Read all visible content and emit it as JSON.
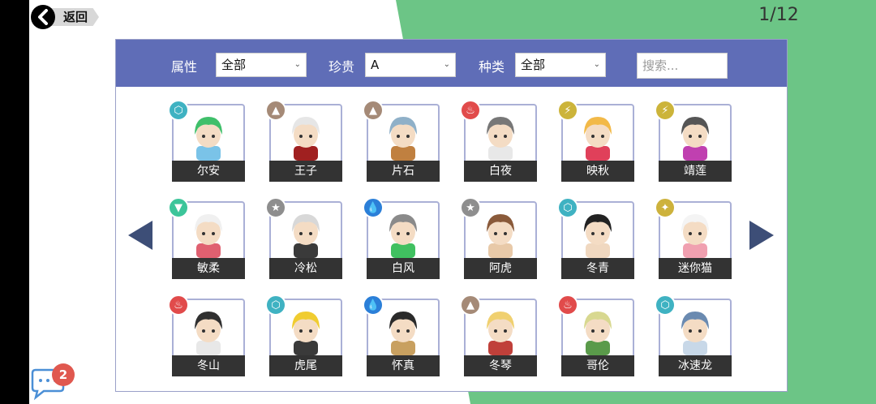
{
  "back": {
    "label": "返回"
  },
  "pagination": {
    "indicator": "1/12"
  },
  "filters": {
    "attribute": {
      "label": "属性",
      "value": "全部"
    },
    "rarity": {
      "label": "珍贵",
      "value": "A"
    },
    "type": {
      "label": "种类",
      "value": "全部"
    },
    "search": {
      "placeholder": "搜索..."
    }
  },
  "elements": {
    "wind": {
      "color": "#3fb2c2",
      "glyph": "⬡"
    },
    "earth": {
      "color": "#a58a77",
      "glyph": "▲"
    },
    "fire": {
      "color": "#e14b4b",
      "glyph": "♨"
    },
    "thunder": {
      "color": "#ccb43a",
      "glyph": "⚡"
    },
    "water": {
      "color": "#2b7fd8",
      "glyph": "💧"
    },
    "nature": {
      "color": "#3cc59a",
      "glyph": "▼"
    },
    "neutral": {
      "color": "#8e8e8e",
      "glyph": "★"
    },
    "light": {
      "color": "#cdb23c",
      "glyph": "✦"
    }
  },
  "characters": [
    {
      "name": "尔安",
      "element": "wind",
      "hair": "#3fbf6a",
      "accent": "#7ac3e8"
    },
    {
      "name": "王子",
      "element": "earth",
      "hair": "#e6e6e6",
      "accent": "#a02020"
    },
    {
      "name": "片石",
      "element": "earth",
      "hair": "#8fb0c8",
      "accent": "#c08040"
    },
    {
      "name": "白夜",
      "element": "fire",
      "hair": "#777777",
      "accent": "#e8e8e8"
    },
    {
      "name": "映秋",
      "element": "thunder",
      "hair": "#f2b948",
      "accent": "#e0405a"
    },
    {
      "name": "靖莲",
      "element": "thunder",
      "hair": "#555555",
      "accent": "#c040b0"
    },
    {
      "name": "敏柔",
      "element": "nature",
      "hair": "#f0f0f0",
      "accent": "#e06070"
    },
    {
      "name": "冷松",
      "element": "neutral",
      "hair": "#d8d8d8",
      "accent": "#3a3a3a"
    },
    {
      "name": "白风",
      "element": "water",
      "hair": "#8a8a8a",
      "accent": "#40c060"
    },
    {
      "name": "阿虎",
      "element": "neutral",
      "hair": "#8a5a3a",
      "accent": "#e8c9a8"
    },
    {
      "name": "冬青",
      "element": "wind",
      "hair": "#222222",
      "accent": "#f0d8c0"
    },
    {
      "name": "迷你猫",
      "element": "light",
      "hair": "#f4f4f4",
      "accent": "#f0a0b0"
    },
    {
      "name": "冬山",
      "element": "fire",
      "hair": "#303030",
      "accent": "#e8e8e8"
    },
    {
      "name": "虎尾",
      "element": "wind",
      "hair": "#f0cc30",
      "accent": "#3a3a3a"
    },
    {
      "name": "怀真",
      "element": "water",
      "hair": "#2a2a2a",
      "accent": "#c8a060"
    },
    {
      "name": "冬琴",
      "element": "earth",
      "hair": "#f0d070",
      "accent": "#c0403a"
    },
    {
      "name": "哥伦",
      "element": "fire",
      "hair": "#d8d890",
      "accent": "#5a9a4a"
    },
    {
      "name": "冰速龙",
      "element": "wind",
      "hair": "#6a8ab0",
      "accent": "#c8d8e8"
    }
  ],
  "chat": {
    "badge_count": "2"
  }
}
